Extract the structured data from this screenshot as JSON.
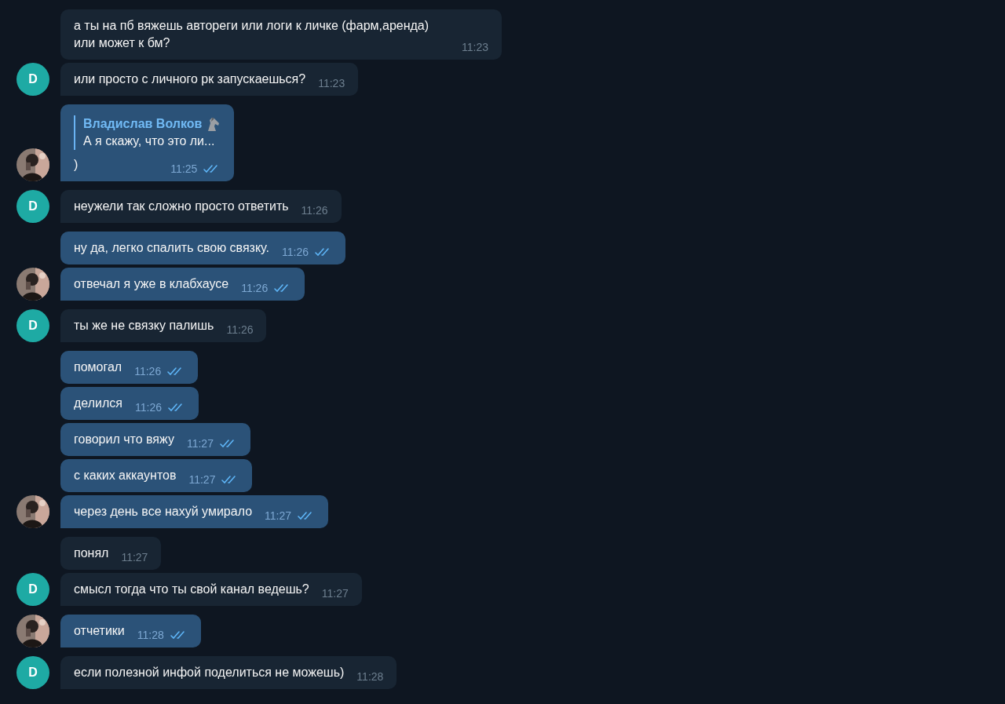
{
  "messages": [
    {
      "kind": "in",
      "text": "а ты на пб вяжешь автореги или логи к личке (фарм,аренда) или может к бм?",
      "time": "11:23",
      "avatar": false
    },
    {
      "kind": "in",
      "text": "или просто с личного рк запускаешься?",
      "time": "11:23",
      "avatar": true,
      "avatar_letter": "D"
    },
    {
      "kind": "out",
      "text": ")",
      "time": "11:25",
      "avatar": true,
      "read": true,
      "reply": {
        "name": "Владислав Волков",
        "text": "А я скажу, что это ли..."
      }
    },
    {
      "kind": "in",
      "text": "неужели так сложно просто ответить",
      "time": "11:26",
      "avatar": true,
      "avatar_letter": "D"
    },
    {
      "kind": "out",
      "text": "ну да, легко спалить свою связку.",
      "time": "11:26",
      "avatar": false,
      "read": true
    },
    {
      "kind": "out",
      "text": "отвечал я уже в клабхаусе",
      "time": "11:26",
      "avatar": true,
      "read": true
    },
    {
      "kind": "in",
      "text": "ты же не связку палишь",
      "time": "11:26",
      "avatar": true,
      "avatar_letter": "D"
    },
    {
      "kind": "out",
      "text": "помогал",
      "time": "11:26",
      "avatar": false,
      "read": true
    },
    {
      "kind": "out",
      "text": "делился",
      "time": "11:26",
      "avatar": false,
      "read": true
    },
    {
      "kind": "out",
      "text": "говорил что вяжу",
      "time": "11:27",
      "avatar": false,
      "read": true
    },
    {
      "kind": "out",
      "text": "с каких аккаунтов",
      "time": "11:27",
      "avatar": false,
      "read": true
    },
    {
      "kind": "out",
      "text": "через день все нахуй умирало",
      "time": "11:27",
      "avatar": true,
      "read": true
    },
    {
      "kind": "in",
      "text": "понял",
      "time": "11:27",
      "avatar": false
    },
    {
      "kind": "in",
      "text": "смысл тогда что ты свой канал ведешь?",
      "time": "11:27",
      "avatar": true,
      "avatar_letter": "D"
    },
    {
      "kind": "out",
      "text": "отчетики",
      "time": "11:28",
      "avatar": true,
      "read": true
    },
    {
      "kind": "in",
      "text": "если полезной инфой поделиться не можешь)",
      "time": "11:28",
      "avatar": true,
      "avatar_letter": "D"
    }
  ]
}
